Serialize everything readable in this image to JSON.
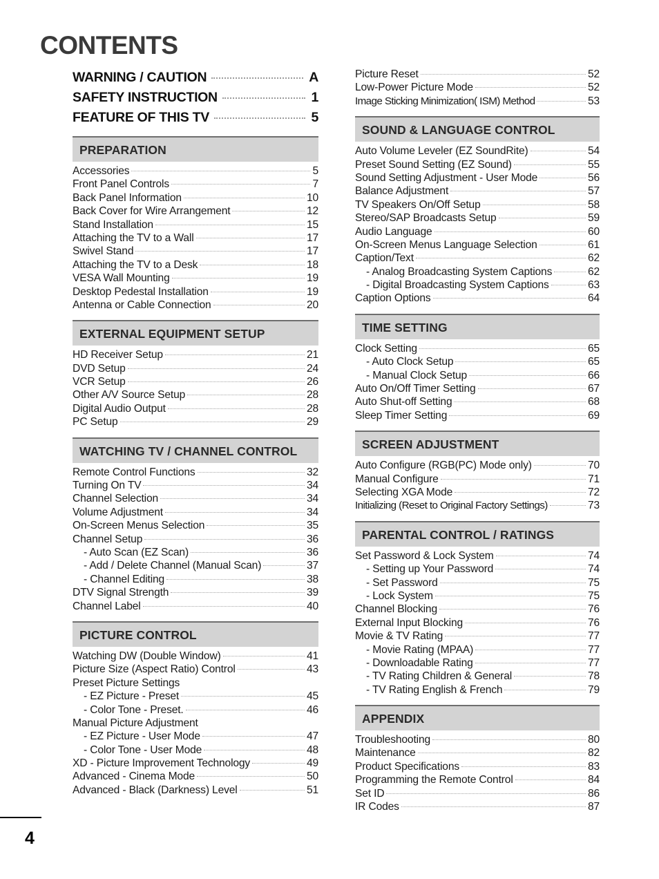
{
  "page": {
    "title": "CONTENTS",
    "page_number": "4"
  },
  "major_entries": [
    {
      "label": "WARNING / CAUTION",
      "page": "A"
    },
    {
      "label": "SAFETY INSTRUCTION",
      "page": "1"
    },
    {
      "label": "FEATURE OF THIS TV",
      "page": "5"
    }
  ],
  "left_column": {
    "sections": [
      {
        "heading": "PREPARATION",
        "entries": [
          {
            "label": "Accessories",
            "page": "5"
          },
          {
            "label": "Front Panel Controls",
            "page": "7"
          },
          {
            "label": "Back Panel Information",
            "page": "10"
          },
          {
            "label": "Back Cover for Wire Arrangement",
            "page": "12"
          },
          {
            "label": "Stand Installation",
            "page": "15"
          },
          {
            "label": "Attaching the TV to a Wall",
            "page": "17"
          },
          {
            "label": "Swivel Stand",
            "page": "17"
          },
          {
            "label": "Attaching the TV to a Desk",
            "page": "18"
          },
          {
            "label": "VESA Wall Mounting",
            "page": "19"
          },
          {
            "label": "Desktop Pedestal Installation",
            "page": "19"
          },
          {
            "label": "Antenna or Cable Connection",
            "page": "20"
          }
        ]
      },
      {
        "heading": "EXTERNAL EQUIPMENT SETUP",
        "entries": [
          {
            "label": "HD Receiver Setup",
            "page": "21"
          },
          {
            "label": "DVD Setup",
            "page": "24"
          },
          {
            "label": "VCR Setup",
            "page": "26"
          },
          {
            "label": "Other A/V Source Setup",
            "page": "28"
          },
          {
            "label": "Digital Audio Output",
            "page": "28"
          },
          {
            "label": "PC Setup",
            "page": "29"
          }
        ]
      },
      {
        "heading": "WATCHING TV / CHANNEL CONTROL",
        "entries": [
          {
            "label": "Remote Control Functions",
            "page": "32"
          },
          {
            "label": "Turning On TV",
            "page": "34"
          },
          {
            "label": "Channel Selection",
            "page": "34"
          },
          {
            "label": "Volume Adjustment",
            "page": "34"
          },
          {
            "label": "On-Screen Menus Selection",
            "page": "35"
          },
          {
            "label": "Channel Setup",
            "page": "36"
          },
          {
            "label": "- Auto Scan (EZ Scan)",
            "page": "36",
            "sub": true
          },
          {
            "label": "- Add / Delete Channel (Manual Scan)",
            "page": "37",
            "sub": true
          },
          {
            "label": "- Channel Editing",
            "page": "38",
            "sub": true
          },
          {
            "label": "DTV Signal Strength",
            "page": "39"
          },
          {
            "label": "Channel Label",
            "page": "40"
          }
        ]
      },
      {
        "heading": "PICTURE CONTROL",
        "entries": [
          {
            "label": "Watching DW (Double Window)",
            "page": "41"
          },
          {
            "label": "Picture Size (Aspect Ratio) Control",
            "page": "43"
          },
          {
            "label": "Preset Picture Settings",
            "page": "",
            "noleader": true
          },
          {
            "label": "- EZ Picture - Preset",
            "page": "45",
            "sub": true
          },
          {
            "label": "- Color Tone - Preset.",
            "page": "46",
            "sub": true
          },
          {
            "label": "Manual Picture Adjustment",
            "page": "",
            "noleader": true
          },
          {
            "label": "- EZ Picture - User Mode",
            "page": "47",
            "sub": true
          },
          {
            "label": "- Color Tone - User Mode",
            "page": "48",
            "sub": true
          },
          {
            "label": "XD - Picture Improvement Technology",
            "page": "49"
          },
          {
            "label": "Advanced - Cinema Mode",
            "page": "50"
          },
          {
            "label": "Advanced - Black (Darkness) Level",
            "page": "51"
          }
        ]
      }
    ]
  },
  "right_column": {
    "lead_entries": [
      {
        "label": "Picture Reset",
        "page": "52"
      },
      {
        "label": "Low-Power Picture Mode",
        "page": "52"
      },
      {
        "label": "Image Sticking Minimization( ISM) Method",
        "page": "53",
        "tight": true
      }
    ],
    "sections": [
      {
        "heading": "SOUND & LANGUAGE CONTROL",
        "entries": [
          {
            "label": "Auto Volume Leveler (EZ SoundRite)",
            "page": "54"
          },
          {
            "label": "Preset Sound Setting (EZ Sound)",
            "page": "55"
          },
          {
            "label": "Sound Setting Adjustment - User Mode",
            "page": "56"
          },
          {
            "label": "Balance Adjustment",
            "page": "57"
          },
          {
            "label": "TV Speakers On/Off Setup",
            "page": "58"
          },
          {
            "label": "Stereo/SAP Broadcasts Setup",
            "page": "59"
          },
          {
            "label": "Audio Language",
            "page": "60"
          },
          {
            "label": "On-Screen Menus Language Selection",
            "page": "61"
          },
          {
            "label": "Caption/Text",
            "page": "62"
          },
          {
            "label": "- Analog Broadcasting System Captions",
            "page": "62",
            "sub": true
          },
          {
            "label": "- Digital Broadcasting System Captions",
            "page": "63",
            "sub": true
          },
          {
            "label": "Caption Options",
            "page": "64"
          }
        ]
      },
      {
        "heading": "TIME SETTING",
        "entries": [
          {
            "label": "Clock Setting",
            "page": "65"
          },
          {
            "label": "- Auto Clock Setup",
            "page": "65",
            "sub": true
          },
          {
            "label": "- Manual Clock Setup",
            "page": "66",
            "sub": true
          },
          {
            "label": "Auto On/Off Timer Setting",
            "page": "67"
          },
          {
            "label": "Auto Shut-off Setting",
            "page": "68"
          },
          {
            "label": "Sleep Timer Setting",
            "page": "69"
          }
        ]
      },
      {
        "heading": "SCREEN ADJUSTMENT",
        "entries": [
          {
            "label": "Auto Configure (RGB(PC) Mode only)",
            "page": "70"
          },
          {
            "label": "Manual Configure",
            "page": "71"
          },
          {
            "label": "Selecting XGA Mode",
            "page": "72"
          },
          {
            "label": "Initializing (Reset to Original Factory Settings)",
            "page": "73",
            "tight": true
          }
        ]
      },
      {
        "heading": "PARENTAL CONTROL / RATINGS",
        "entries": [
          {
            "label": "Set Password & Lock System",
            "page": "74"
          },
          {
            "label": "- Setting up Your Password",
            "page": "74",
            "sub": true
          },
          {
            "label": "- Set Password",
            "page": "75",
            "sub": true
          },
          {
            "label": "- Lock System",
            "page": "75",
            "sub": true
          },
          {
            "label": "Channel Blocking",
            "page": "76"
          },
          {
            "label": "External Input Blocking",
            "page": "76"
          },
          {
            "label": "Movie & TV Rating",
            "page": "77"
          },
          {
            "label": "- Movie Rating (MPAA)",
            "page": "77",
            "sub": true
          },
          {
            "label": "- Downloadable Rating",
            "page": "77",
            "sub": true
          },
          {
            "label": "- TV Rating Children & General",
            "page": "78",
            "sub": true
          },
          {
            "label": "- TV Rating English & French",
            "page": "79",
            "sub": true
          }
        ]
      },
      {
        "heading": "APPENDIX",
        "entries": [
          {
            "label": "Troubleshooting",
            "page": "80"
          },
          {
            "label": "Maintenance",
            "page": "82"
          },
          {
            "label": "Product Specifications",
            "page": "83"
          },
          {
            "label": "Programming the Remote Control",
            "page": "84"
          },
          {
            "label": "Set ID",
            "page": "86"
          },
          {
            "label": "IR Codes",
            "page": "87"
          }
        ]
      }
    ]
  }
}
